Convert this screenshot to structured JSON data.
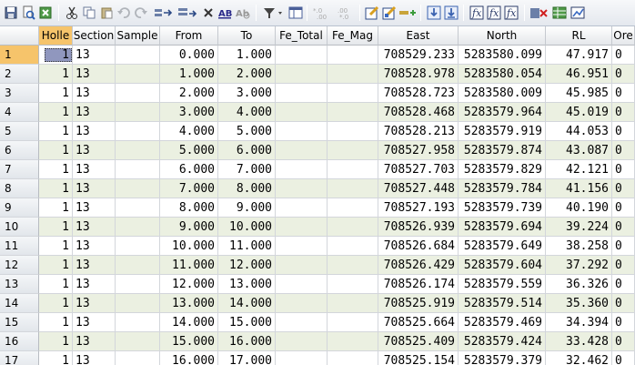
{
  "toolbar": {
    "icons": [
      "save-icon",
      "print-preview-icon",
      "export-icon",
      "cut-icon",
      "copy-icon",
      "paste-icon",
      "undo-icon",
      "redo-icon",
      "insert-row-icon",
      "append-row-icon",
      "delete-icon",
      "find-icon",
      "replace-icon",
      "filter-icon",
      "column-chooser-icon",
      "decimal-increase-icon",
      "decimal-decrease-icon",
      "edit-icon",
      "edit-validate-icon",
      "merge-icon",
      "import-icon",
      "download-icon",
      "calc-icon",
      "calc2-icon",
      "calc3-icon",
      "clear-icon",
      "table-icon",
      "chart-icon"
    ]
  },
  "grid": {
    "columns": [
      "Holle",
      "Section",
      "Sample",
      "From",
      "To",
      "Fe_Total",
      "Fe_Mag",
      "East",
      "North",
      "RL",
      "Ore"
    ],
    "rows": [
      {
        "n": "1",
        "hole": "1",
        "section": "13",
        "sample": "",
        "from": "0.000",
        "to": "1.000",
        "fe_total": "",
        "fe_mag": "",
        "east": "708529.233",
        "north": "5283580.099",
        "rl": "47.917",
        "ore": "0"
      },
      {
        "n": "2",
        "hole": "1",
        "section": "13",
        "sample": "",
        "from": "1.000",
        "to": "2.000",
        "fe_total": "",
        "fe_mag": "",
        "east": "708528.978",
        "north": "5283580.054",
        "rl": "46.951",
        "ore": "0"
      },
      {
        "n": "3",
        "hole": "1",
        "section": "13",
        "sample": "",
        "from": "2.000",
        "to": "3.000",
        "fe_total": "",
        "fe_mag": "",
        "east": "708528.723",
        "north": "5283580.009",
        "rl": "45.985",
        "ore": "0"
      },
      {
        "n": "4",
        "hole": "1",
        "section": "13",
        "sample": "",
        "from": "3.000",
        "to": "4.000",
        "fe_total": "",
        "fe_mag": "",
        "east": "708528.468",
        "north": "5283579.964",
        "rl": "45.019",
        "ore": "0"
      },
      {
        "n": "5",
        "hole": "1",
        "section": "13",
        "sample": "",
        "from": "4.000",
        "to": "5.000",
        "fe_total": "",
        "fe_mag": "",
        "east": "708528.213",
        "north": "5283579.919",
        "rl": "44.053",
        "ore": "0"
      },
      {
        "n": "6",
        "hole": "1",
        "section": "13",
        "sample": "",
        "from": "5.000",
        "to": "6.000",
        "fe_total": "",
        "fe_mag": "",
        "east": "708527.958",
        "north": "5283579.874",
        "rl": "43.087",
        "ore": "0"
      },
      {
        "n": "7",
        "hole": "1",
        "section": "13",
        "sample": "",
        "from": "6.000",
        "to": "7.000",
        "fe_total": "",
        "fe_mag": "",
        "east": "708527.703",
        "north": "5283579.829",
        "rl": "42.121",
        "ore": "0"
      },
      {
        "n": "8",
        "hole": "1",
        "section": "13",
        "sample": "",
        "from": "7.000",
        "to": "8.000",
        "fe_total": "",
        "fe_mag": "",
        "east": "708527.448",
        "north": "5283579.784",
        "rl": "41.156",
        "ore": "0"
      },
      {
        "n": "9",
        "hole": "1",
        "section": "13",
        "sample": "",
        "from": "8.000",
        "to": "9.000",
        "fe_total": "",
        "fe_mag": "",
        "east": "708527.193",
        "north": "5283579.739",
        "rl": "40.190",
        "ore": "0"
      },
      {
        "n": "10",
        "hole": "1",
        "section": "13",
        "sample": "",
        "from": "9.000",
        "to": "10.000",
        "fe_total": "",
        "fe_mag": "",
        "east": "708526.939",
        "north": "5283579.694",
        "rl": "39.224",
        "ore": "0"
      },
      {
        "n": "11",
        "hole": "1",
        "section": "13",
        "sample": "",
        "from": "10.000",
        "to": "11.000",
        "fe_total": "",
        "fe_mag": "",
        "east": "708526.684",
        "north": "5283579.649",
        "rl": "38.258",
        "ore": "0"
      },
      {
        "n": "12",
        "hole": "1",
        "section": "13",
        "sample": "",
        "from": "11.000",
        "to": "12.000",
        "fe_total": "",
        "fe_mag": "",
        "east": "708526.429",
        "north": "5283579.604",
        "rl": "37.292",
        "ore": "0"
      },
      {
        "n": "13",
        "hole": "1",
        "section": "13",
        "sample": "",
        "from": "12.000",
        "to": "13.000",
        "fe_total": "",
        "fe_mag": "",
        "east": "708526.174",
        "north": "5283579.559",
        "rl": "36.326",
        "ore": "0"
      },
      {
        "n": "14",
        "hole": "1",
        "section": "13",
        "sample": "",
        "from": "13.000",
        "to": "14.000",
        "fe_total": "",
        "fe_mag": "",
        "east": "708525.919",
        "north": "5283579.514",
        "rl": "35.360",
        "ore": "0"
      },
      {
        "n": "15",
        "hole": "1",
        "section": "13",
        "sample": "",
        "from": "14.000",
        "to": "15.000",
        "fe_total": "",
        "fe_mag": "",
        "east": "708525.664",
        "north": "5283579.469",
        "rl": "34.394",
        "ore": "0"
      },
      {
        "n": "16",
        "hole": "1",
        "section": "13",
        "sample": "",
        "from": "15.000",
        "to": "16.000",
        "fe_total": "",
        "fe_mag": "",
        "east": "708525.409",
        "north": "5283579.424",
        "rl": "33.428",
        "ore": "0"
      },
      {
        "n": "17",
        "hole": "1",
        "section": "13",
        "sample": "",
        "from": "16.000",
        "to": "17.000",
        "fe_total": "",
        "fe_mag": "",
        "east": "708525.154",
        "north": "5283579.379",
        "rl": "32.462",
        "ore": "0"
      }
    ]
  },
  "colors": {
    "row_alt": "#ebf0e1",
    "active_header": "#f6c46b",
    "selection": "#9097be"
  }
}
